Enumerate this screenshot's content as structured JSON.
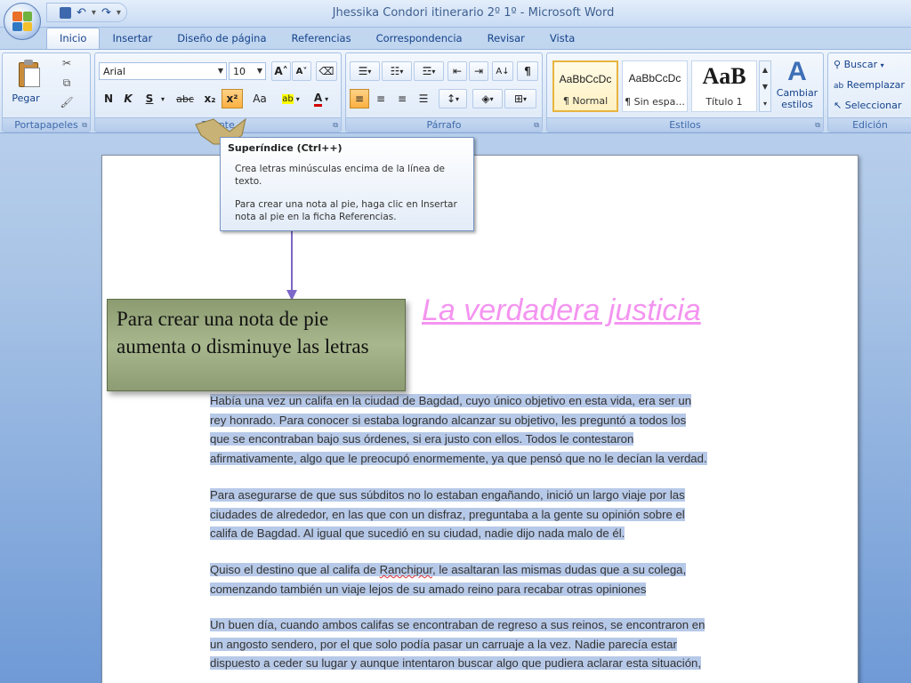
{
  "window": {
    "title": "Jhessika Condori itinerario 2º 1º - Microsoft Word"
  },
  "quick_access": {
    "undo": "↶",
    "redo": "↷",
    "customize": "▾"
  },
  "tabs": [
    {
      "label": "Inicio",
      "active": true
    },
    {
      "label": "Insertar"
    },
    {
      "label": "Diseño de página"
    },
    {
      "label": "Referencias"
    },
    {
      "label": "Correspondencia"
    },
    {
      "label": "Revisar"
    },
    {
      "label": "Vista"
    }
  ],
  "ribbon": {
    "clipboard": {
      "paste_label": "Pegar",
      "group_label": "Portapapeles"
    },
    "font": {
      "font_name": "Arial",
      "font_size": "10",
      "grow": "A˄",
      "shrink": "A˅",
      "bold": "N",
      "italic": "K",
      "underline": "S",
      "strike": "abc",
      "subscript": "x₂",
      "superscript": "x²",
      "case": "Aa",
      "highlight": "ab",
      "font_color": "A",
      "group_label": "Fuente"
    },
    "paragraph": {
      "sort": "A↓",
      "show_marks": "¶",
      "group_label": "Párrafo"
    },
    "styles": {
      "items": [
        {
          "sample": "AaBbCcDc",
          "name": "¶ Normal"
        },
        {
          "sample": "AaBbCcDc",
          "name": "¶ Sin espa..."
        },
        {
          "sample": "AaB",
          "name": "Título 1"
        }
      ],
      "change_styles": "Cambiar estilos",
      "group_label": "Estilos"
    },
    "editing": {
      "find": "Buscar",
      "replace": "Reemplazar",
      "select": "Seleccionar",
      "group_label": "Edición"
    }
  },
  "tooltip": {
    "title": "Superíndice (Ctrl++)",
    "line1": "Crea letras minúsculas encima de la línea de texto.",
    "line2": "Para crear una nota al pie, haga clic en Insertar nota al pie en la ficha Referencias."
  },
  "callout": {
    "text": "Para crear una nota de pie aumenta o disminuye las letras"
  },
  "document": {
    "title": "La verdadera justicia",
    "paragraphs": [
      [
        "Había una vez un califa en la ciudad de Bagdad, cuyo único objetivo en esta vida, era ser un",
        "rey honrado. Para conocer si estaba logrando alcanzar su objetivo, les preguntó a todos los",
        "que se encontraban bajo sus órdenes, si era justo con ellos. Todos le contestaron",
        "afirmativamente, algo que le preocupó enormemente, ya que pensó que no le decían la verdad."
      ],
      [
        "Para asegurarse de que sus súbditos no lo estaban engañando, inició un largo viaje por las",
        "ciudades de alrededor, en las que con un disfraz, preguntaba a la gente su opinión sobre el",
        "califa de Bagdad. Al igual que sucedió en su ciudad, nadie dijo nada malo de él."
      ],
      [
        "Quiso el destino que al califa de ",
        "Ranchipur",
        ", le asaltaran las mismas dudas que a su colega,",
        "comenzando también un viaje lejos de su amado reino para recabar otras opiniones"
      ],
      [
        "Un buen día, cuando ambos califas se encontraban de regreso a sus reinos, se encontraron en",
        "un angosto sendero, por el que solo podía pasar un carruaje a la vez. Nadie parecía estar",
        "dispuesto a ceder su lugar y aunque intentaron buscar algo que pudiera aclarar esta situación,"
      ]
    ]
  },
  "colors": {
    "title_text": "#f494f0",
    "selection": "#b7c9e8",
    "callout": "#a8b78d",
    "arrow": "#7b68c8",
    "bracket": "#c9b275"
  }
}
